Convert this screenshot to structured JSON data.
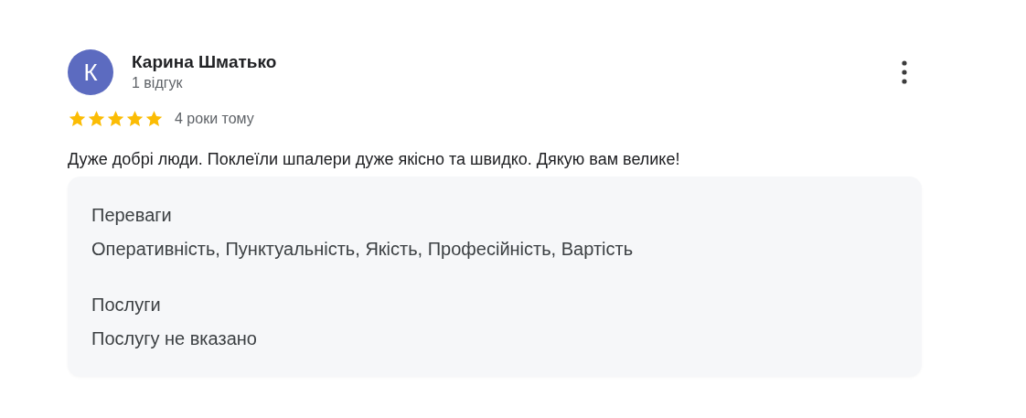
{
  "review": {
    "avatar_letter": "К",
    "author": "Карина Шматько",
    "review_count": "1 відгук",
    "stars": 5,
    "date": "4 роки тому",
    "text": "Дуже добрі люди. Поклеїли шпалери дуже якісно та швидко. Дякую вам велике!",
    "details": [
      {
        "label": "Переваги",
        "value": "Оперативність, Пунктуальність, Якість, Професійність, Вартість"
      },
      {
        "label": "Послуги",
        "value": "Послугу не вказано"
      }
    ]
  }
}
